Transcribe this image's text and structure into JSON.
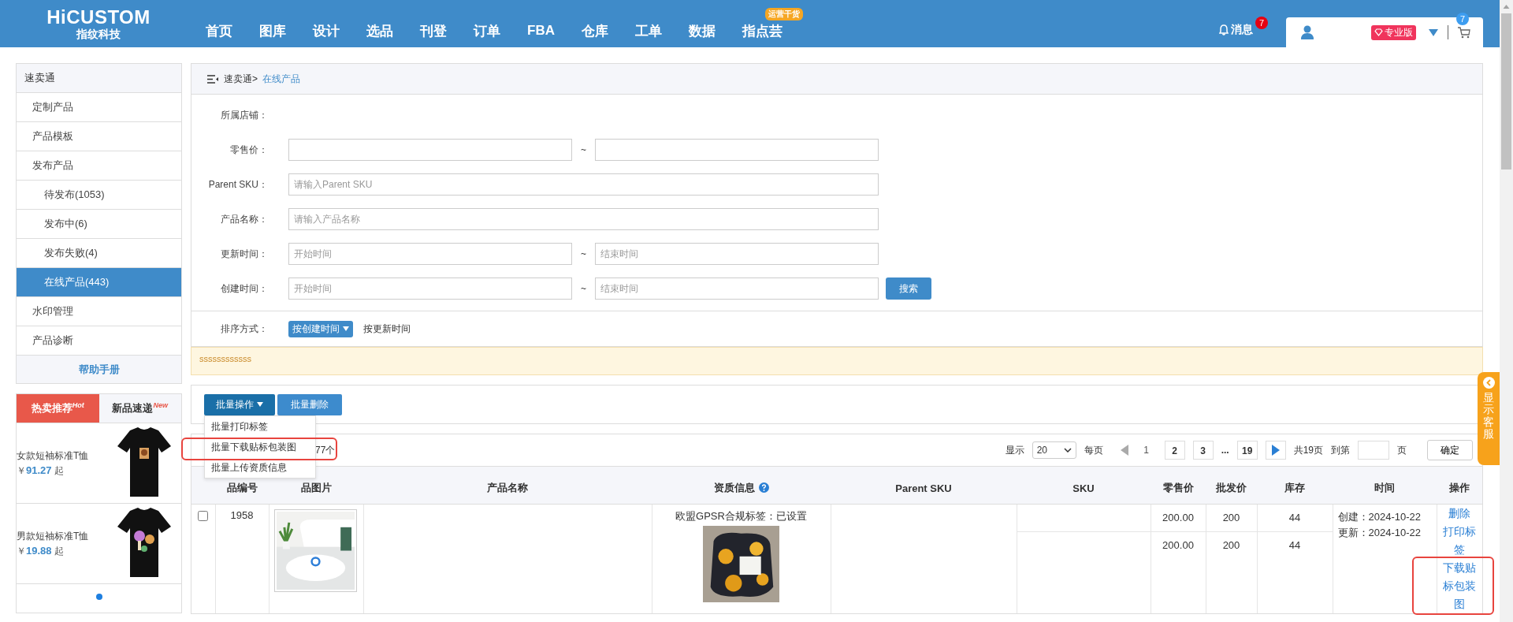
{
  "header": {
    "logo": "HiCUSTOM",
    "logo_sub": "指纹科技",
    "nav": [
      {
        "label": "首页"
      },
      {
        "label": "图库"
      },
      {
        "label": "设计"
      },
      {
        "label": "选品"
      },
      {
        "label": "刊登"
      },
      {
        "label": "订单"
      },
      {
        "label": "FBA"
      },
      {
        "label": "仓库"
      },
      {
        "label": "工单"
      },
      {
        "label": "数据"
      },
      {
        "label": "指点芸",
        "badge": "运营干货"
      }
    ],
    "messages": {
      "label": "消息",
      "count": "7"
    },
    "plan": "专业版",
    "cart_count": "7"
  },
  "sidebar": {
    "title": "速卖通",
    "items": [
      {
        "label": "定制产品",
        "selected": false
      },
      {
        "label": "产品模板",
        "selected": false
      },
      {
        "label": "发布产品",
        "selected": false,
        "children": [
          {
            "label": "待发布(1053)",
            "selected": false
          },
          {
            "label": "发布中(6)",
            "selected": false
          },
          {
            "label": "发布失败(4)",
            "selected": false
          },
          {
            "label": "在线产品(443)",
            "selected": true
          }
        ]
      },
      {
        "label": "水印管理",
        "selected": false
      },
      {
        "label": "产品诊断",
        "selected": false
      }
    ],
    "help": "帮助手册"
  },
  "promo": {
    "tabs": [
      {
        "label": "热卖推荐",
        "tag": "Hot",
        "selected": true
      },
      {
        "label": "新品速递",
        "tag": "New",
        "selected": false
      }
    ],
    "products": [
      {
        "name": "女款短袖标准T恤",
        "currency": "￥",
        "price": "91.27",
        "suffix": "起",
        "kind": "picture"
      },
      {
        "name": "男款短袖标准T恤",
        "currency": "￥",
        "price": "19.88",
        "suffix": "起",
        "kind": "picture"
      }
    ]
  },
  "breadcrumb": {
    "parent": "速卖通>",
    "current": "在线产品"
  },
  "filters": [
    {
      "kind": "plain",
      "label": "所属店铺："
    },
    {
      "kind": "range",
      "label": "零售价：",
      "separator": "~"
    },
    {
      "kind": "text",
      "label": "Parent SKU：",
      "placeholder": "请输入Parent SKU"
    },
    {
      "kind": "text",
      "label": "产品名称：",
      "placeholder": "请输入产品名称"
    },
    {
      "kind": "range",
      "label": "更新时间：",
      "separator": "~",
      "placeholder_from": "开始时间",
      "placeholder_to": "结束时间"
    },
    {
      "kind": "range",
      "label": "创建时间：",
      "separator": "~",
      "placeholder_from": "开始时间",
      "placeholder_to": "结束时间",
      "action": "搜索"
    }
  ],
  "sort": {
    "label": "排序方式：",
    "options": [
      {
        "label": "按创建时间",
        "selected": true
      },
      {
        "label": "按更新时间",
        "selected": false
      }
    ]
  },
  "notice": "ssssssssssss",
  "bulk": {
    "menu_button": "批量操作",
    "expanded": true,
    "menu": [
      "批量打印标签",
      "批量下载贴标包装图",
      "批量上传资质信息"
    ],
    "delete": "批量删除"
  },
  "select_all_count": "77个",
  "pagination": {
    "show_label": "显示",
    "page_size": "20",
    "per_page": "每页",
    "prev_disabled": true,
    "pages": [
      {
        "label": "1",
        "kind": "page",
        "selected": true
      },
      {
        "label": "2",
        "kind": "page",
        "selected": false
      },
      {
        "label": "3",
        "kind": "page",
        "selected": false
      },
      {
        "label": "...",
        "kind": "gap"
      },
      {
        "label": "19",
        "kind": "page",
        "selected": false
      }
    ],
    "total": "共19页",
    "goto": "到第",
    "page_unit": "页",
    "confirm": "确定"
  },
  "table": {
    "columns": [
      {
        "label": "品编号"
      },
      {
        "label": "品图片"
      },
      {
        "label": "产品名称"
      },
      {
        "label": "资质信息",
        "help": true
      },
      {
        "label": "Parent SKU"
      },
      {
        "label": "SKU"
      },
      {
        "label": "零售价"
      },
      {
        "label": "批发价"
      },
      {
        "label": "库存"
      },
      {
        "label": "时间"
      },
      {
        "label": "操作"
      }
    ],
    "rows": [
      {
        "checked": false,
        "id": "1958",
        "image": {
          "kind": "picture"
        },
        "qualification": "欧盟GPSR合规标签：已设置",
        "qualification_image": {
          "kind": "picture"
        },
        "variants": [
          {
            "retail": "200.00",
            "wholesale": "200",
            "stock": "44"
          },
          {
            "retail": "200.00",
            "wholesale": "200",
            "stock": "44"
          }
        ],
        "created": "创建：2024-10-22",
        "updated": "更新：2024-10-22",
        "actions": [
          "删除",
          "打印标签",
          "下载贴标包装图"
        ]
      }
    ]
  },
  "help_tab": "显示客服"
}
